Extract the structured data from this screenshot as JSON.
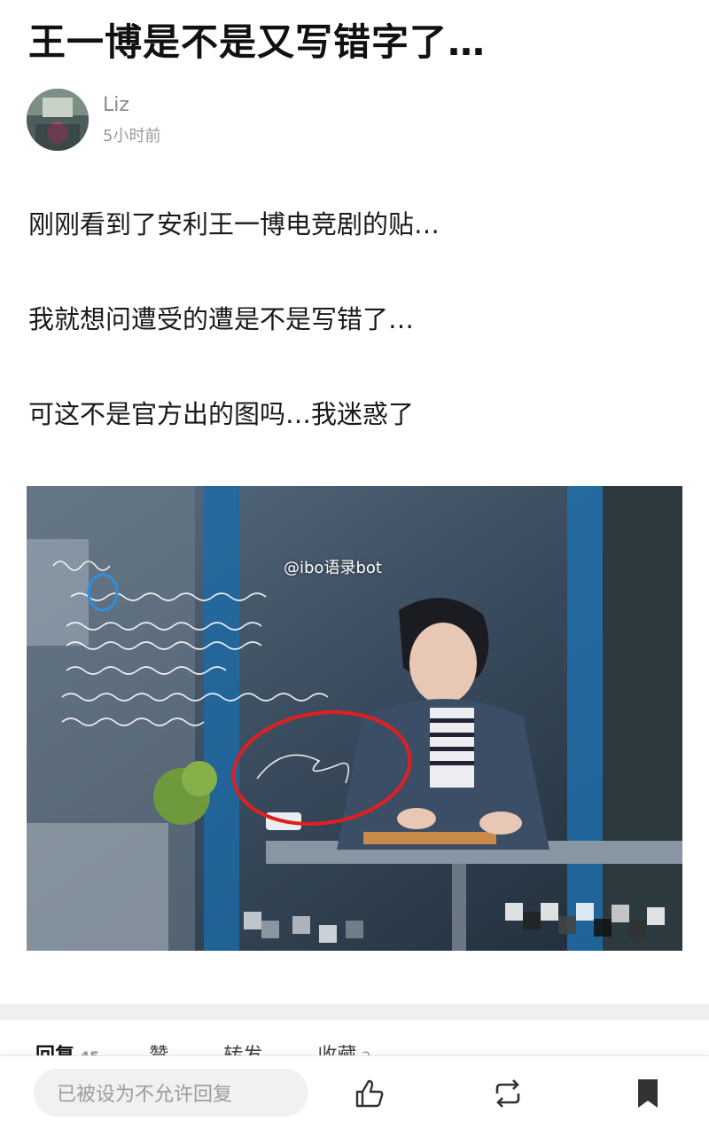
{
  "post": {
    "title": "王一博是不是又写错字了…",
    "author": "Liz",
    "time": "5小时前",
    "paragraphs": [
      "刚刚看到了安利王一博电竞剧的贴…",
      "我就想问遭受的遭是不是写错了…",
      "可这不是官方出的图吗…我迷惑了"
    ]
  },
  "image": {
    "watermark": "@ibo语录bot",
    "handwriting_lines": [
      "To: 季向空",
      "你遭受过各种各样的质疑",
      "但梦想支撑你击碎所有犹豫",
      "你带着所有人的希望不断前行",
      "乐观，热血，无所畏惧",
      "终将带领你在逐梦的路上走得更远",
      "直到世界之巅！"
    ]
  },
  "tabs": [
    {
      "label": "回复",
      "count": "45"
    },
    {
      "label": "赞",
      "count": ""
    },
    {
      "label": "转发",
      "count": ""
    },
    {
      "label": "收藏",
      "count": "2"
    }
  ],
  "bottom_bar": {
    "reply_placeholder": "已被设为不允许回复",
    "icons": [
      "thumbs-up-icon",
      "repost-icon",
      "bookmark-icon"
    ]
  }
}
